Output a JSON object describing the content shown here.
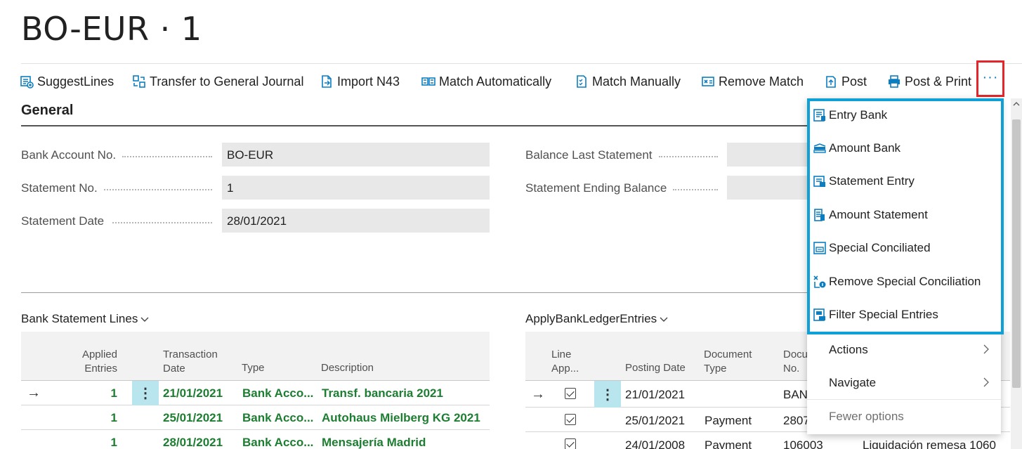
{
  "page": {
    "title": "BO-EUR · 1"
  },
  "toolbar": {
    "suggest_lines": "SuggestLines",
    "transfer": "Transfer to General Journal",
    "import_n43": "Import N43",
    "match_auto": "Match Automatically",
    "match_manual": "Match Manually",
    "remove_match": "Remove Match",
    "post": "Post",
    "post_print": "Post & Print",
    "more": "···"
  },
  "general": {
    "heading": "General",
    "fields": {
      "bank_account_no": {
        "label": "Bank Account No.",
        "value": "BO-EUR"
      },
      "statement_no": {
        "label": "Statement No.",
        "value": "1"
      },
      "statement_date": {
        "label": "Statement Date",
        "value": "28/01/2021"
      },
      "balance_last": {
        "label": "Balance Last Statement",
        "value": ""
      },
      "ending_balance": {
        "label": "Statement Ending Balance",
        "value": ""
      }
    }
  },
  "bank_lines": {
    "title": "Bank Statement Lines",
    "columns": [
      "Applied Entries",
      "Transaction Date",
      "Type",
      "Description"
    ],
    "col_applied_1": "Applied",
    "col_applied_2": "Entries",
    "col_tdate_1": "Transaction",
    "col_tdate_2": "Date",
    "col_type": "Type",
    "col_desc": "Description",
    "rows": [
      {
        "applied": "1",
        "date": "21/01/2021",
        "type": "Bank Acco...",
        "description": "Transf. bancaria 2021"
      },
      {
        "applied": "1",
        "date": "25/01/2021",
        "type": "Bank Acco...",
        "description": "Autohaus Mielberg KG 2021"
      },
      {
        "applied": "1",
        "date": "28/01/2021",
        "type": "Bank Acco...",
        "description": "Mensajería Madrid"
      }
    ]
  },
  "ledger": {
    "title": "ApplyBankLedgerEntries",
    "col_lineapp_1": "Line",
    "col_lineapp_2": "App...",
    "col_posting": "Posting Date",
    "col_doctype_1": "Document",
    "col_doctype_2": "Type",
    "col_docno_1": "Docu",
    "col_docno_2": "No.",
    "rows": [
      {
        "posting": "21/01/2021",
        "doctype": "",
        "docno": "BAN",
        "description": ""
      },
      {
        "posting": "25/01/2021",
        "doctype": "Payment",
        "docno": "2807",
        "description": ""
      },
      {
        "posting": "24/01/2008",
        "doctype": "Payment",
        "docno": "106003",
        "description": "Liquidación remesa 1060"
      }
    ]
  },
  "more_menu": {
    "entry_bank": "Entry Bank",
    "amount_bank": "Amount Bank",
    "statement_entry": "Statement Entry",
    "amount_statement": "Amount Statement",
    "special_conciliated": "Special Conciliated",
    "remove_special": "Remove Special Conciliation",
    "filter_special": "Filter Special Entries",
    "actions": "Actions",
    "navigate": "Navigate",
    "fewer_options": "Fewer options"
  },
  "colors": {
    "accent": "#0b7ec1",
    "highlight_red": "#e3262b",
    "highlight_blue": "#0fa0d8",
    "positive_green": "#1d7e31",
    "selected_cell": "#b9e5ee"
  }
}
